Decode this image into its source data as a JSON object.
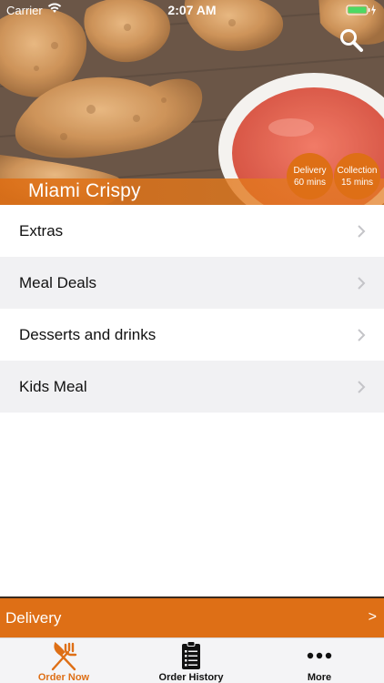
{
  "status_bar": {
    "carrier": "Carrier",
    "time": "2:07 AM"
  },
  "hero": {
    "restaurant_name": "Miami Crispy",
    "delivery_badge": {
      "line1": "Delivery",
      "line2": "60 mins"
    },
    "collection_badge": {
      "line1": "Collection",
      "line2": "15 mins"
    },
    "search_icon": "search-icon"
  },
  "menu": {
    "items": [
      {
        "label": "Extras"
      },
      {
        "label": "Meal Deals"
      },
      {
        "label": "Desserts and drinks"
      },
      {
        "label": "Kids Meal"
      }
    ]
  },
  "delivery_bar": {
    "label": "Delivery",
    "arrow": ">"
  },
  "tab_bar": {
    "tabs": [
      {
        "label": "Order Now",
        "icon": "fork-knife-icon",
        "active": true
      },
      {
        "label": "Order History",
        "icon": "clipboard-list-icon",
        "active": false
      },
      {
        "label": "More",
        "icon": "more-dots-icon",
        "active": false
      }
    ]
  },
  "colors": {
    "accent": "#de6f16",
    "row_alt": "#f1f1f3",
    "tab_bar_bg": "#f4f4f6"
  }
}
